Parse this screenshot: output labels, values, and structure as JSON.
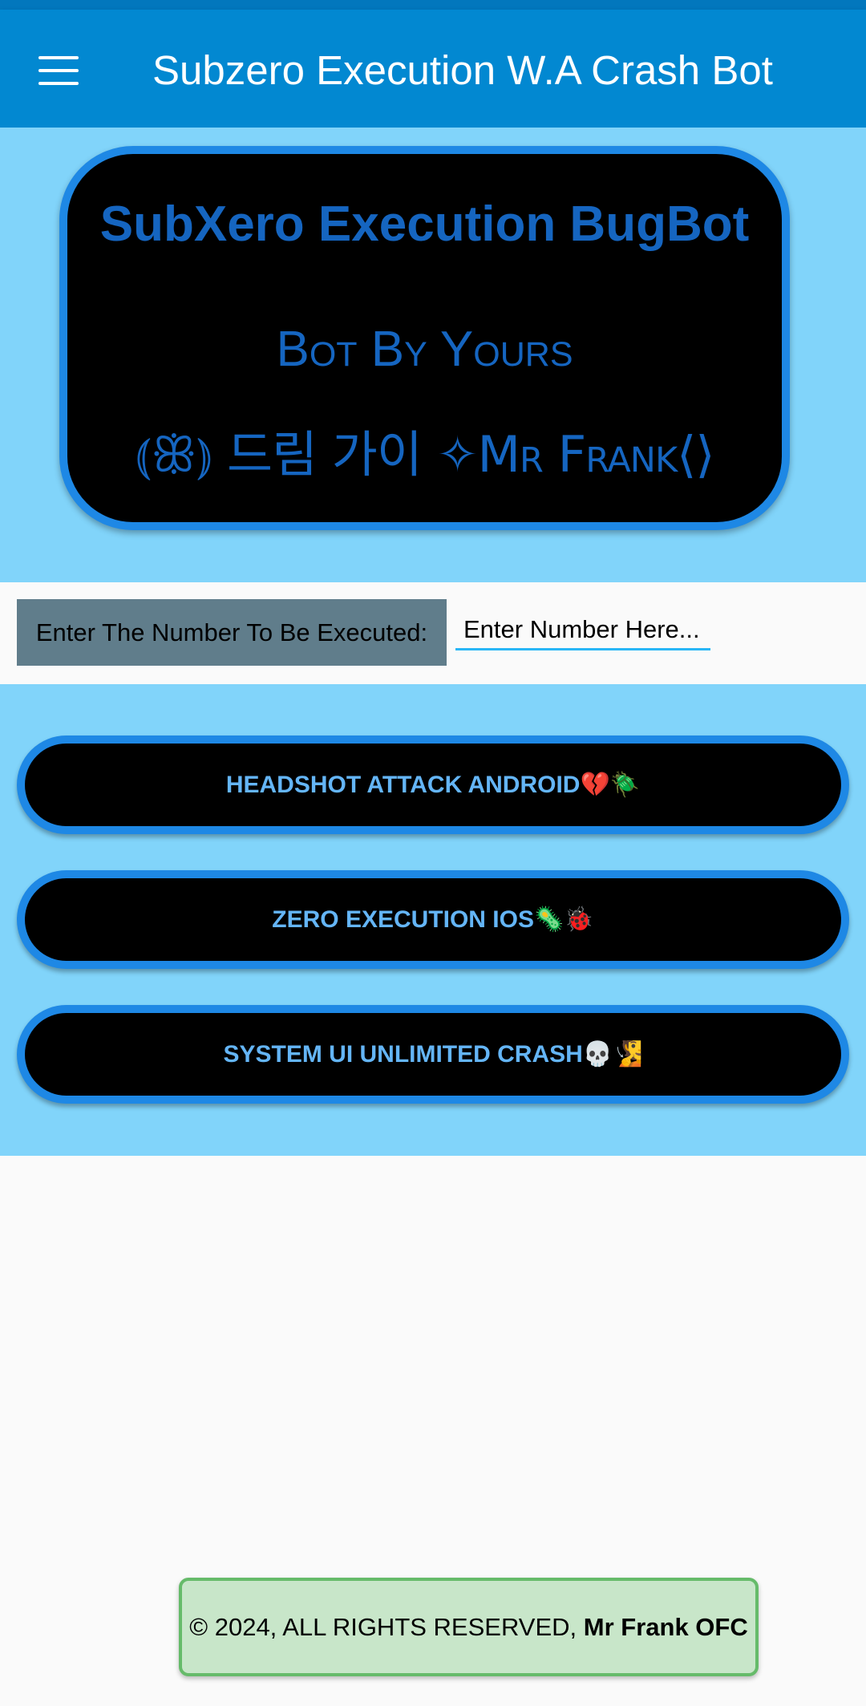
{
  "appbar": {
    "title": "Subzero Execution W.A Crash Bot",
    "menu_icon": "hamburger-menu-icon"
  },
  "hero": {
    "title": "SubXero Execution BugBot",
    "subtitle": "Bot By Yours",
    "signature": "⦅ꕥ⦆ 드림 가이 ✧Mr Frank⟨⟩"
  },
  "form": {
    "label": "Enter The Number To Be Executed:",
    "placeholder": "Enter Number Here...",
    "value": ""
  },
  "buttons": [
    {
      "label": "HEADSHOT ATTACK ANDROID💔🪲"
    },
    {
      "label": "ZERO EXECUTION IOS🦠🐞"
    },
    {
      "label": "SYSTEM UI UNLIMITED CRASH💀🧏"
    }
  ],
  "footer": {
    "text": "© 2024, ALL RIGHTS RESERVED, ",
    "owner": "Mr Frank OFC"
  },
  "colors": {
    "appbar": "#0288d1",
    "band": "#81d4fa",
    "accent": "#1e88e5",
    "hero_text": "#1565c0",
    "button_text": "#64b5f6",
    "footer_bg": "#c8e6c9"
  }
}
